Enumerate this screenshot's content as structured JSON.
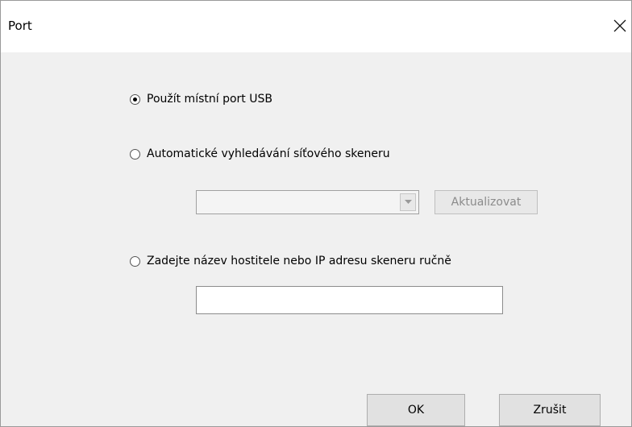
{
  "window": {
    "title": "Port"
  },
  "options": {
    "usb": {
      "label": "Použít místní port USB",
      "checked": true
    },
    "auto": {
      "label": "Automatické vyhledávání síťového skeneru",
      "checked": false
    },
    "manual": {
      "label": "Zadejte název hostitele nebo IP adresu skeneru ručně",
      "checked": false
    }
  },
  "scanner_select": {
    "value": ""
  },
  "refresh_button": {
    "label": "Aktualizovat",
    "enabled": false
  },
  "host_input": {
    "value": ""
  },
  "buttons": {
    "ok": "OK",
    "cancel": "Zrušit"
  }
}
